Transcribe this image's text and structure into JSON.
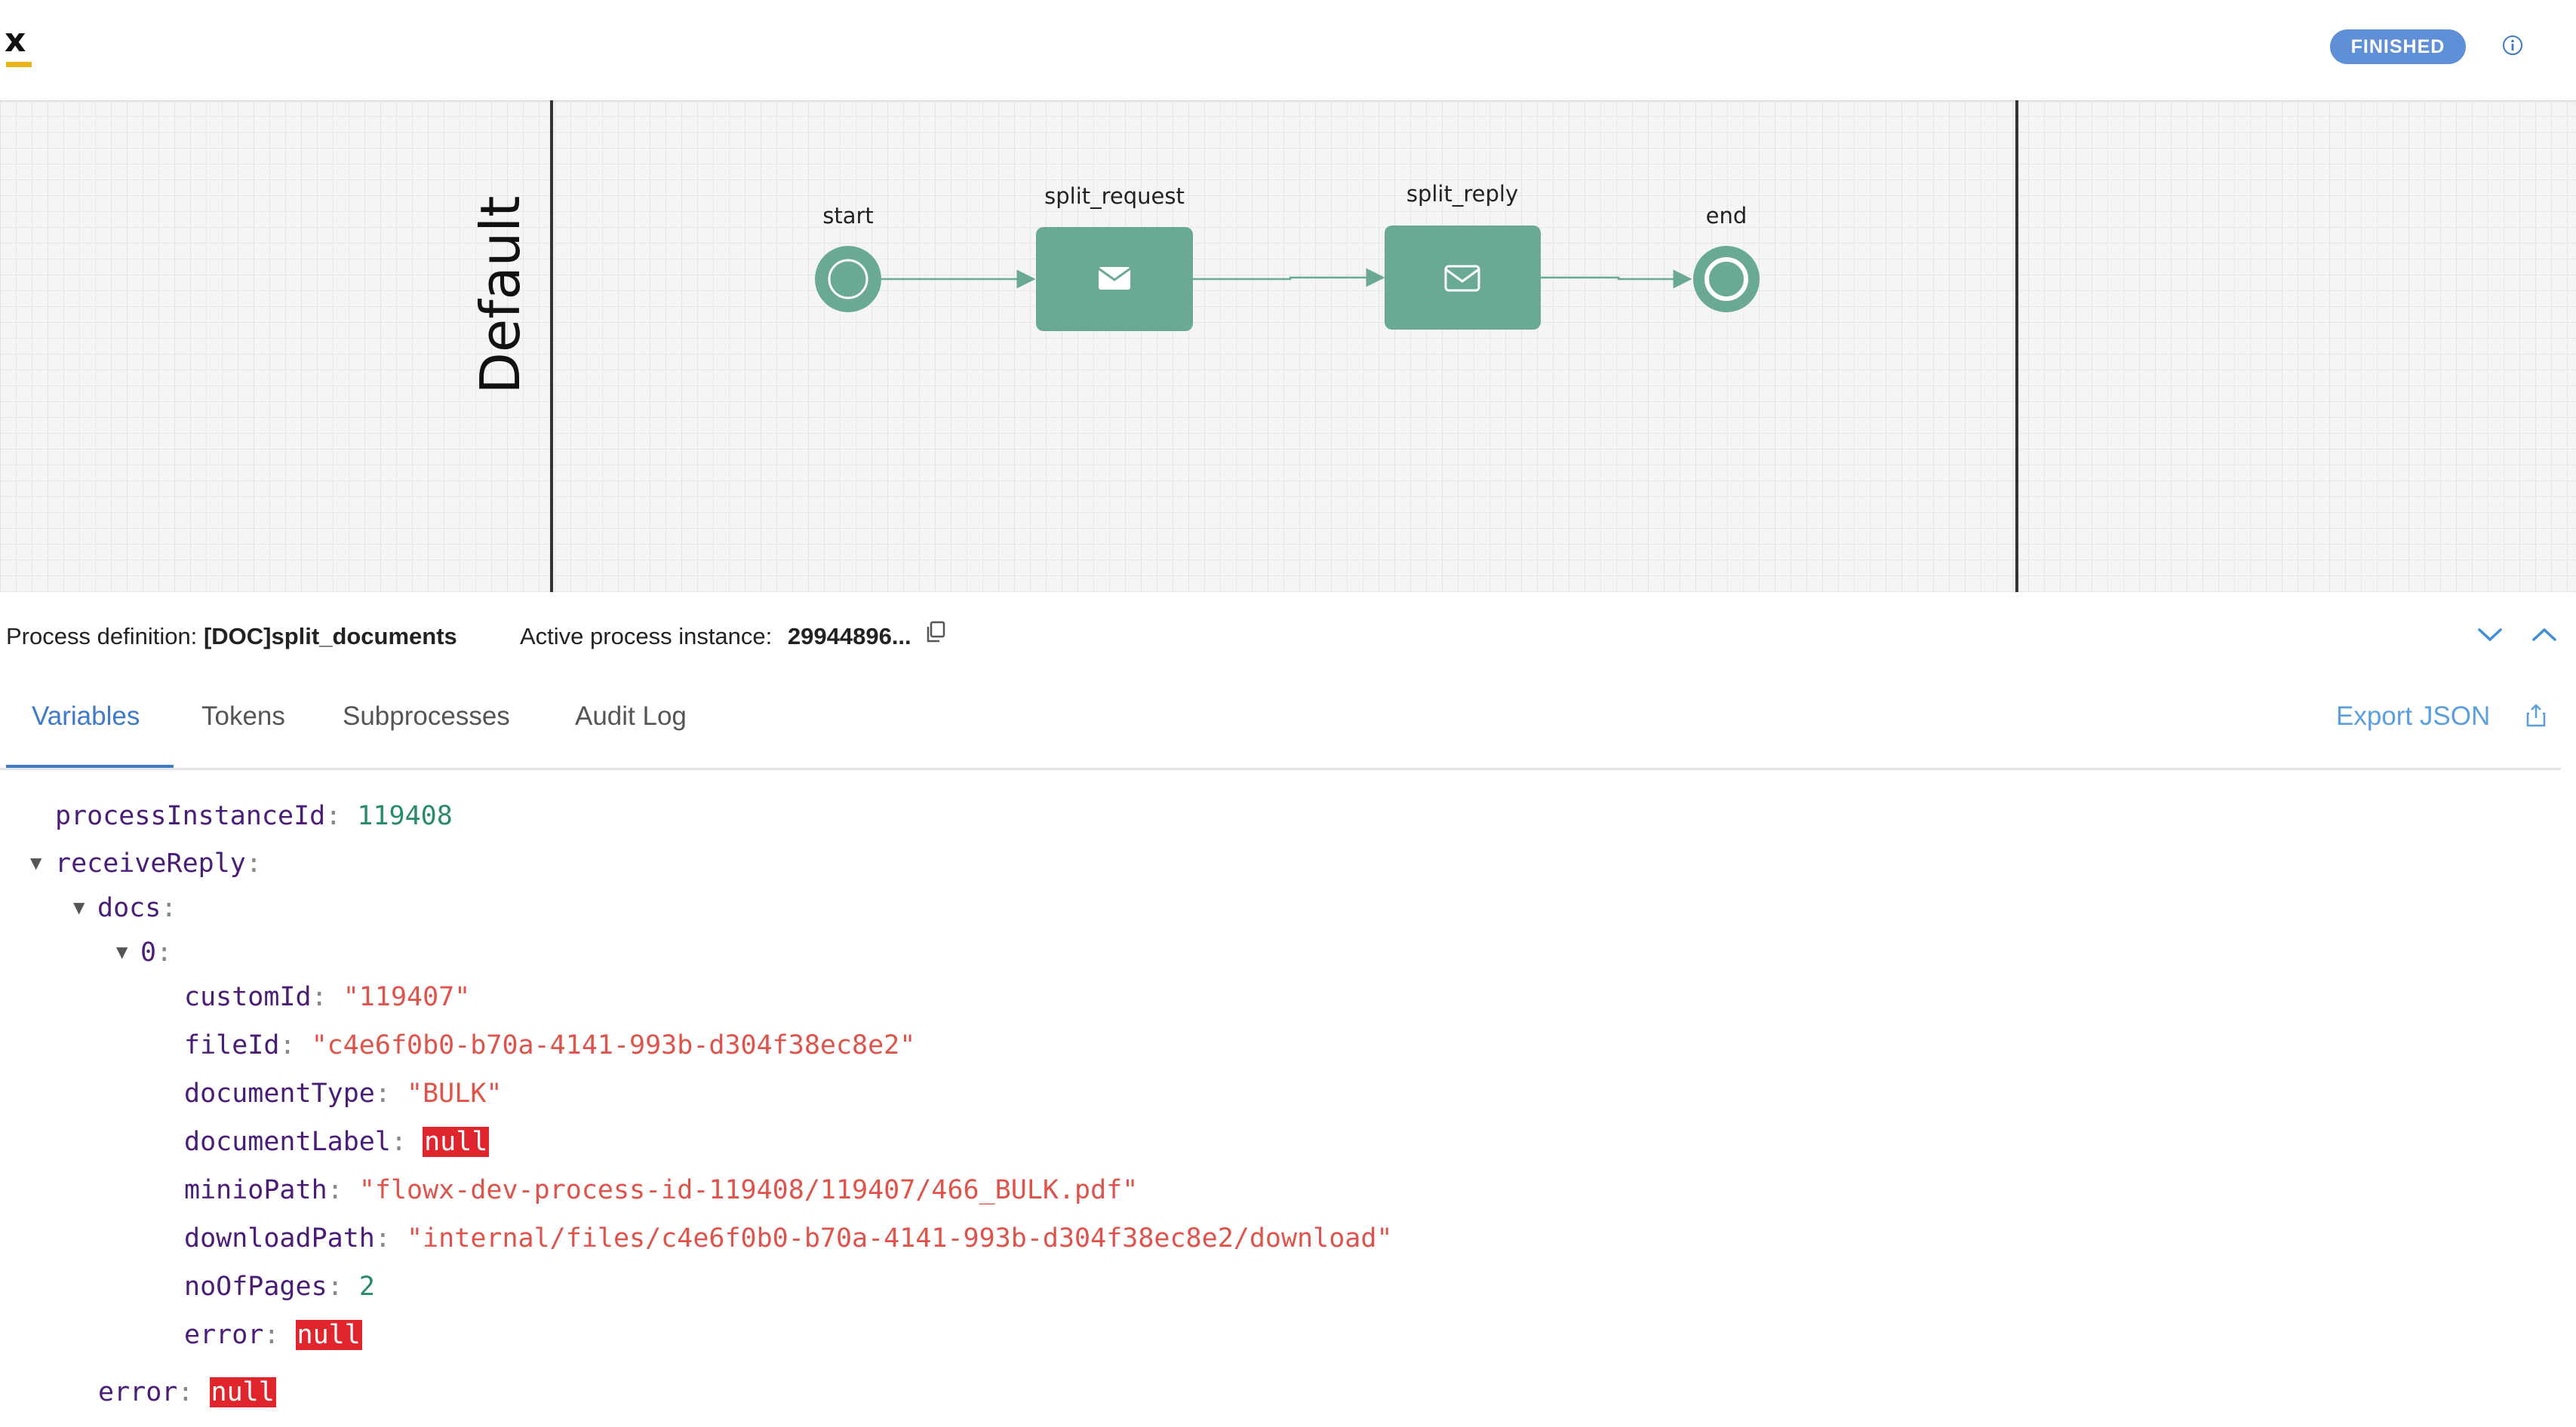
{
  "header": {
    "logo_text": "x",
    "status_badge": "FINISHED",
    "brand_accent": "#e9b317",
    "badge_color": "#5f8fd7"
  },
  "diagram": {
    "lane_label": "Default",
    "nodes": {
      "start": "start",
      "split_request": "split_request",
      "split_reply": "split_reply",
      "end": "end"
    },
    "node_color": "#6aaa94"
  },
  "info_bar": {
    "process_definition_label": "Process definition:",
    "process_definition_value": "[DOC]split_documents",
    "active_instance_label": "Active process instance:",
    "active_instance_value": "29944896..."
  },
  "tabs": [
    {
      "label": "Variables",
      "active": true
    },
    {
      "label": "Tokens",
      "active": false
    },
    {
      "label": "Subprocesses",
      "active": false
    },
    {
      "label": "Audit Log",
      "active": false
    }
  ],
  "export_label": "Export JSON",
  "variables": {
    "processInstanceId": {
      "key": "processInstanceId",
      "value": "119408"
    },
    "receiveReply": {
      "key": "receiveReply"
    },
    "docs": {
      "key": "docs"
    },
    "index0": {
      "key": "0"
    },
    "customId": {
      "key": "customId",
      "value": "\"119407\""
    },
    "fileId": {
      "key": "fileId",
      "value": "\"c4e6f0b0-b70a-4141-993b-d304f38ec8e2\""
    },
    "documentType": {
      "key": "documentType",
      "value": "\"BULK\""
    },
    "documentLabel": {
      "key": "documentLabel",
      "value": "null"
    },
    "minioPath": {
      "key": "minioPath",
      "value": "\"flowx-dev-process-id-119408/119407/466_BULK.pdf\""
    },
    "downloadPath": {
      "key": "downloadPath",
      "value": "\"internal/files/c4e6f0b0-b70a-4141-993b-d304f38ec8e2/download\""
    },
    "noOfPages": {
      "key": "noOfPages",
      "value": "2"
    },
    "error_inner": {
      "key": "error",
      "value": "null"
    },
    "error_outer": {
      "key": "error",
      "value": "null"
    }
  }
}
